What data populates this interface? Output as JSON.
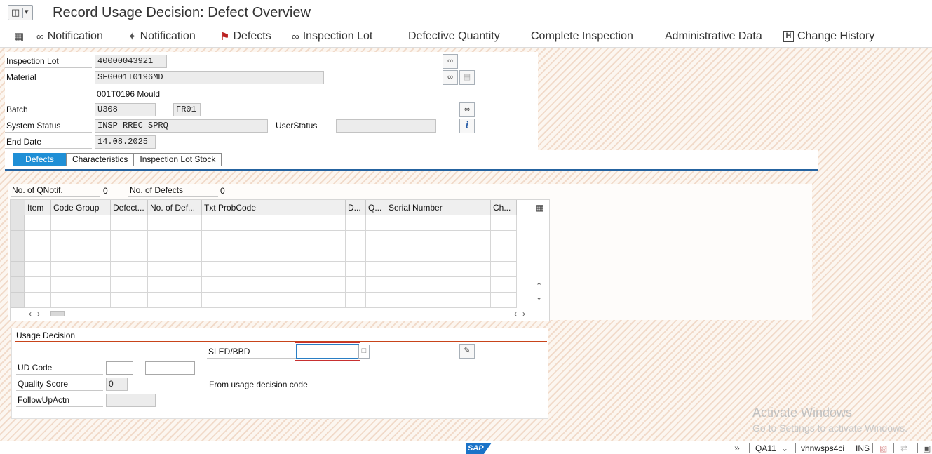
{
  "window": {
    "title": "Record Usage Decision: Defect Overview"
  },
  "toolbar": {
    "items": [
      {
        "label": "Notification",
        "icon": "glasses-icon"
      },
      {
        "label": "Notification",
        "icon": "wand-icon"
      },
      {
        "label": "Defects",
        "icon": "flag-icon"
      },
      {
        "label": "Inspection Lot",
        "icon": "glasses-icon"
      },
      {
        "label": "Defective Quantity"
      },
      {
        "label": "Complete Inspection"
      },
      {
        "label": "Administrative Data"
      },
      {
        "label": "Change History",
        "icon": "h-box-icon"
      }
    ]
  },
  "header": {
    "inspection_lot": {
      "label": "Inspection Lot",
      "value": "40000043921"
    },
    "material": {
      "label": "Material",
      "value": "SFG001T0196MD",
      "description": "001T0196 Mould"
    },
    "batch": {
      "label": "Batch",
      "value": "U308",
      "plant": "FR01"
    },
    "system_status": {
      "label": "System Status",
      "value": "INSP RREC SPRQ"
    },
    "user_status": {
      "label": "UserStatus",
      "value": ""
    },
    "end_date": {
      "label": "End Date",
      "value": "14.08.2025"
    }
  },
  "tabs": [
    {
      "label": "Defects",
      "active": true
    },
    {
      "label": "Characteristics",
      "active": false
    },
    {
      "label": "Inspection Lot Stock",
      "active": false
    }
  ],
  "defects_tab": {
    "qnotif_label": "No. of QNotif.",
    "qnotif_value": "0",
    "defects_label": "No. of Defects",
    "defects_value": "0",
    "table": {
      "columns": [
        "Item",
        "Code Group",
        "Defect...",
        "No. of Def...",
        "Txt ProbCode",
        "D...",
        "Q...",
        "Serial Number",
        "Ch..."
      ],
      "rows": [
        [],
        [],
        [],
        [],
        [],
        []
      ]
    }
  },
  "usage_decision": {
    "title": "Usage Decision",
    "sled_label": "SLED/BBD",
    "sled_value": "",
    "ud_code_label": "UD Code",
    "ud_code_group": "",
    "ud_code": "",
    "quality_score_label": "Quality Score",
    "quality_score": "0",
    "followup_label": "FollowUpActn",
    "followup_value": "",
    "ud_description": "From usage decision code"
  },
  "watermark": {
    "line1": "Activate Windows",
    "line2": "Go to Settings to activate Windows."
  },
  "statusbar": {
    "logo": "SAP",
    "system": "QA11",
    "server": "vhnwsps4ci",
    "mode": "INS"
  }
}
